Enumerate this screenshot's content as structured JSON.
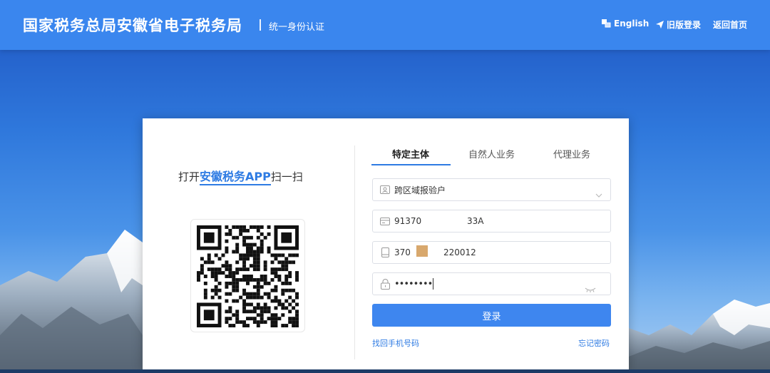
{
  "header": {
    "title": "国家税务总局安徽省电子税务局",
    "subtitle": "统一身份认证",
    "nav": [
      {
        "label": "English",
        "icon": "globe-flag-icon"
      },
      {
        "label": "旧版登录",
        "icon": "send-arrow-icon"
      },
      {
        "label": "返回首页",
        "icon": ""
      }
    ]
  },
  "left_panel": {
    "scan_prefix": "打开",
    "scan_app": "安徽税务APP",
    "scan_suffix": "扫一扫"
  },
  "tabs": [
    {
      "label": "特定主体",
      "active": true
    },
    {
      "label": "自然人业务",
      "active": false
    },
    {
      "label": "代理业务",
      "active": false
    }
  ],
  "form": {
    "type_select": {
      "value": "跨区域报验户",
      "icon": "user-card-icon"
    },
    "taxpayer_id": {
      "value_start": "91370",
      "value_end": "33A",
      "icon": "id-card-icon"
    },
    "account": {
      "value_start": "370",
      "value_end": "220012",
      "icon": "phone-icon"
    },
    "password": {
      "value": "••••••••",
      "icon": "lock-icon"
    },
    "login_label": "登录",
    "forgot_phone_label": "找回手机号码",
    "forgot_password_label": "忘记密码"
  },
  "colors": {
    "header_bg": "#3a86ee",
    "accent": "#2e7be3",
    "button": "#3e86ef"
  }
}
